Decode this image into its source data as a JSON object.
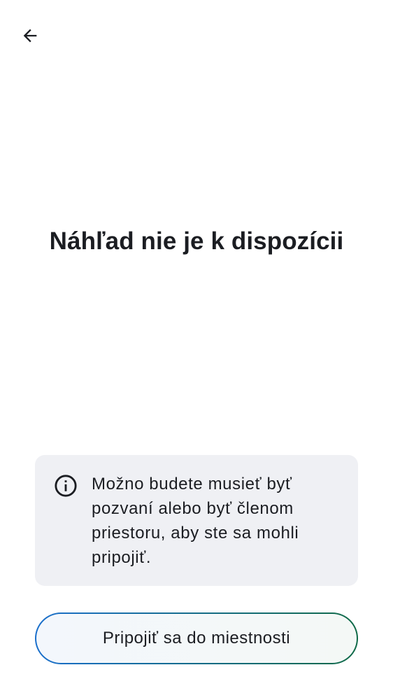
{
  "header": {
    "back_icon": "arrow-left-icon"
  },
  "main": {
    "title": "Náhľad nie je k dispozícii"
  },
  "info_card": {
    "icon": "info-icon",
    "message": "Možno budete musieť byť pozvaní alebo byť členom priestoru, aby ste sa mohli pripojiť."
  },
  "actions": {
    "join_label": "Pripojiť sa do miestnosti"
  },
  "colors": {
    "background": "#ffffff",
    "card_background": "#eff0f4",
    "text": "#1b1d22",
    "button_border_start": "#1a6fcc",
    "button_border_end": "#0f6a47"
  }
}
